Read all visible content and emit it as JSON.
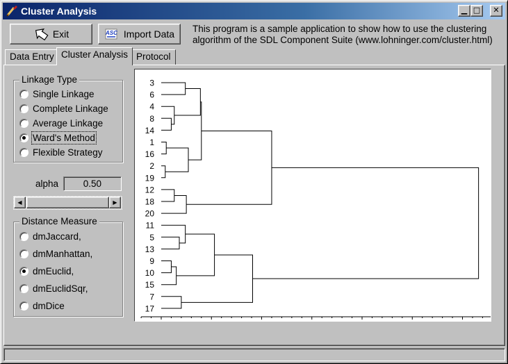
{
  "window": {
    "title": "Cluster Analysis",
    "controls": [
      "minimize",
      "maximize",
      "close"
    ]
  },
  "toolbar": {
    "exit_label": "Exit",
    "import_label": "Import Data",
    "info_text": "This program is a sample application to show how to use the clustering algorithm of the SDL Component Suite (www.lohninger.com/cluster.html)"
  },
  "tabs": [
    {
      "label": "Data Entry",
      "active": false
    },
    {
      "label": "Cluster Analysis",
      "active": true
    },
    {
      "label": "Protocol",
      "active": false
    }
  ],
  "linkage": {
    "title": "Linkage Type",
    "options": [
      "Single Linkage",
      "Complete Linkage",
      "Average Linkage",
      "Ward's Method",
      "Flexible Strategy"
    ],
    "selected": "Ward's Method"
  },
  "alpha": {
    "label": "alpha",
    "value": "0.50"
  },
  "distance": {
    "title": "Distance Measure",
    "options": [
      "dmJaccard,",
      "dmManhattan,",
      "dmEuclid,",
      "dmEuclidSqr,",
      "dmDice"
    ],
    "selected": "dmEuclid,"
  },
  "status": {
    "text": ""
  },
  "chart_data": {
    "type": "dendrogram",
    "leaves": [
      "3",
      "6",
      "4",
      "8",
      "14",
      "1",
      "16",
      "2",
      "19",
      "12",
      "18",
      "20",
      "11",
      "5",
      "13",
      "9",
      "10",
      "15",
      "7",
      "17"
    ],
    "xticks": [
      0,
      100,
      200,
      300
    ],
    "xlim": [
      -20,
      330
    ],
    "merges": [
      {
        "a": "L:3",
        "b": "L:6",
        "h": 24
      },
      {
        "a": "L:8",
        "b": "L:14",
        "h": 10
      },
      {
        "a": "L:4",
        "b": "M1",
        "h": 13
      },
      {
        "a": "M0",
        "b": "M2",
        "h": 39
      },
      {
        "a": "L:1",
        "b": "L:16",
        "h": 5
      },
      {
        "a": "L:2",
        "b": "L:19",
        "h": 4
      },
      {
        "a": "M4",
        "b": "M5",
        "h": 27
      },
      {
        "a": "M3",
        "b": "M6",
        "h": 40
      },
      {
        "a": "L:12",
        "b": "L:18",
        "h": 13
      },
      {
        "a": "M8",
        "b": "L:20",
        "h": 25
      },
      {
        "a": "M7",
        "b": "M9",
        "h": 110
      },
      {
        "a": "L:5",
        "b": "L:13",
        "h": 18
      },
      {
        "a": "L:11",
        "b": "M11",
        "h": 24
      },
      {
        "a": "L:9",
        "b": "L:10",
        "h": 10
      },
      {
        "a": "M13",
        "b": "L:15",
        "h": 15
      },
      {
        "a": "M12",
        "b": "M14",
        "h": 53
      },
      {
        "a": "L:7",
        "b": "L:17",
        "h": 20
      },
      {
        "a": "M15",
        "b": "M16",
        "h": 91
      },
      {
        "a": "M10",
        "b": "M17",
        "h": 316
      }
    ]
  }
}
